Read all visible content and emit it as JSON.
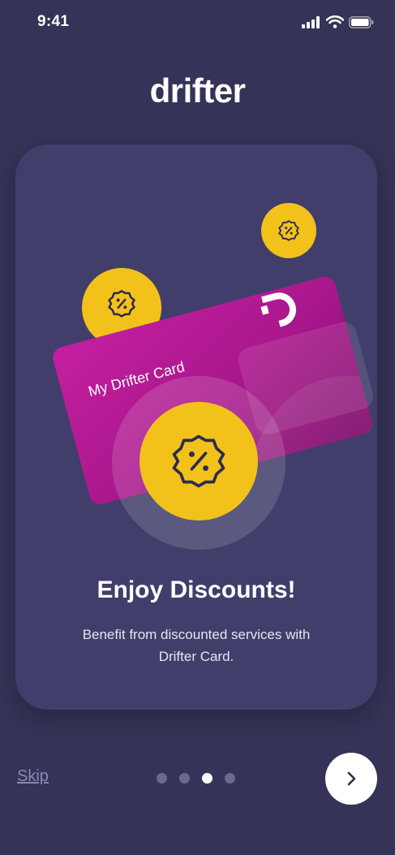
{
  "status_bar": {
    "time": "9:41",
    "icons": [
      "signal-icon",
      "wifi-icon",
      "battery-icon"
    ]
  },
  "app": {
    "logo_text": "drifter"
  },
  "onboarding": {
    "card_label": "My Drifter Card",
    "title": "Enjoy Discounts!",
    "description": "Benefit from discounted services with Drifter Card.",
    "step_current": 3,
    "step_total": 4
  },
  "footer": {
    "skip_label": "Skip",
    "next_icon": "chevron-right-icon"
  },
  "colors": {
    "background": "#353357",
    "card": "#413e6b",
    "accent_yellow": "#f2c21b",
    "card_magenta": "#b51d96",
    "dot_inactive": "#6c6990"
  }
}
